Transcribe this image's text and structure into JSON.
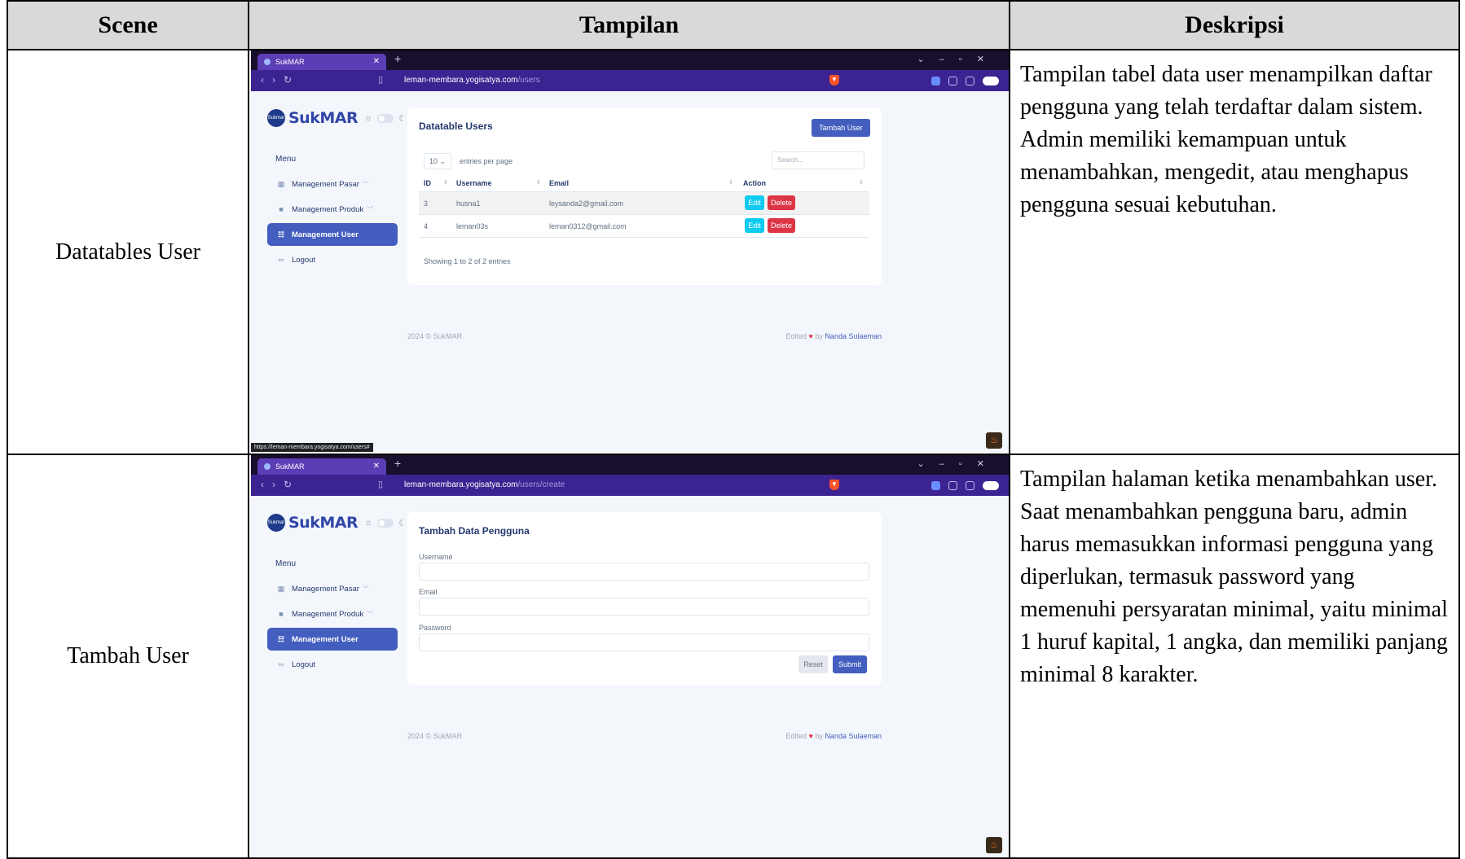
{
  "headers": {
    "scene": "Scene",
    "tampilan": "Tampilan",
    "deskripsi": "Deskripsi"
  },
  "rows": [
    {
      "scene": "Datatables User",
      "description": "Tampilan tabel data user menampilkan daftar pengguna yang telah terdaftar dalam sistem. Admin memiliki kemampuan untuk menambahkan, mengedit, atau menghapus pengguna sesuai kebutuhan.",
      "screen": {
        "tab_title": "SukMAR",
        "url_host": "leman-membara.yogisatya.com",
        "url_path": "/users",
        "status_url": "https://leman-membara.yogisatya.com/users#",
        "card_title": "Datatable Users",
        "add_button": "Tambah User",
        "entries_value": "10",
        "entries_label": "entries per page",
        "search_placeholder": "Search...",
        "columns": [
          "ID",
          "Username",
          "Email",
          "Action"
        ],
        "users": [
          {
            "id": "3",
            "username": "husna1",
            "email": "leysanda2@gmail.com"
          },
          {
            "id": "4",
            "username": "leman03s",
            "email": "leman0312@gmail.com"
          }
        ],
        "edit_label": "Edit",
        "delete_label": "Delete",
        "info": "Showing 1 to 2 of 2 entries"
      }
    },
    {
      "scene": "Tambah User",
      "description": "Tampilan halaman ketika menambahkan user. Saat menambahkan pengguna baru, admin harus memasukkan informasi pengguna yang diperlukan, termasuk password yang memenuhi persyaratan minimal, yaitu minimal 1 huruf kapital, 1 angka, dan memiliki panjang minimal 8 karakter.",
      "screen": {
        "tab_title": "SukMAR",
        "url_host": "leman-membara.yogisatya.com",
        "url_path": "/users/create",
        "card_title": "Tambah Data Pengguna",
        "fields": [
          "Username",
          "Email",
          "Password"
        ],
        "reset_label": "Reset",
        "submit_label": "Submit"
      }
    }
  ],
  "app": {
    "brand": "SukMAR",
    "logo_text": "Sukmar",
    "menu_heading": "Menu",
    "menu_items": [
      "Management Pasar",
      "Management Produk",
      "Management User",
      "Logout"
    ],
    "footer_left": "2024 © SukMAR",
    "footer_edited": "Edited",
    "footer_by": "by",
    "footer_author": "Nanda Sulaeman"
  },
  "colors": {
    "primary": "#435ebe",
    "info": "#0dcaf0",
    "danger": "#dc3545",
    "browser_tabbar": "#170f2b",
    "browser_addressbar": "#3b2391"
  },
  "icons": [
    "tab-favicon-icon",
    "close-icon",
    "plus-icon",
    "back-icon",
    "forward-icon",
    "reload-icon",
    "bookmark-icon",
    "brave-shield-icon",
    "sun-icon",
    "moon-icon",
    "grid-icon",
    "bag-icon",
    "users-icon",
    "logout-icon",
    "chevron-down-icon",
    "heart-icon",
    "flame-icon"
  ]
}
